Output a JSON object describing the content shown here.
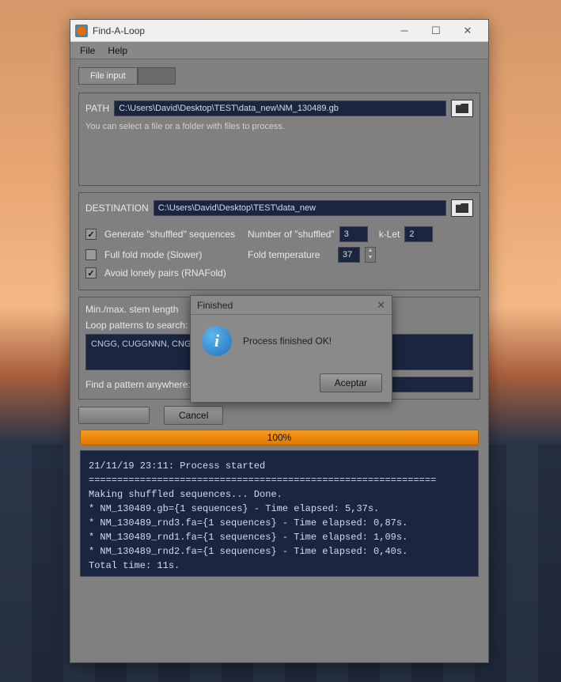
{
  "window": {
    "title": "Find-A-Loop",
    "menu": {
      "file": "File",
      "help": "Help"
    }
  },
  "tabs": {
    "active": "File input"
  },
  "path": {
    "label": "PATH",
    "value": "C:\\Users\\David\\Desktop\\TEST\\data_new\\NM_130489.gb",
    "hint": "You can select a file or a folder with files to process."
  },
  "destination": {
    "label": "DESTINATION",
    "value": "C:\\Users\\David\\Desktop\\TEST\\data_new"
  },
  "options": {
    "generateShuffled": "Generate \"shuffled\" sequences",
    "numberShuffledLabel": "Number of \"shuffled\"",
    "numberShuffledValue": "3",
    "kLetLabel": "k-Let",
    "kLetValue": "2",
    "fullFold": "Full fold mode (Slower)",
    "foldTempLabel": "Fold temperature",
    "foldTempValue": "37",
    "avoidLonely": "Avoid lonely pairs (RNAFold)"
  },
  "stem": {
    "minmaxLabel": "Min./max. stem length",
    "loopLabel": "Loop patterns to search:",
    "loopValue": "CNGG, CUGGNNN, CNGG",
    "findPatternLabel": "Find a pattern anywhere:"
  },
  "buttons": {
    "cancel": "Cancel"
  },
  "progress": {
    "text": "100%"
  },
  "log": "21/11/19 23:11: Process started\n=============================================================\nMaking shuffled sequences... Done.\n* NM_130489.gb={1 sequences} - Time elapsed: 5,37s.\n* NM_130489_rnd3.fa={1 sequences} - Time elapsed: 0,87s.\n* NM_130489_rnd1.fa={1 sequences} - Time elapsed: 1,09s.\n* NM_130489_rnd2.fa={1 sequences} - Time elapsed: 0,40s.\nTotal time: 11s.",
  "dialog": {
    "title": "Finished",
    "message": "Process finished OK!",
    "accept": "Aceptar"
  }
}
